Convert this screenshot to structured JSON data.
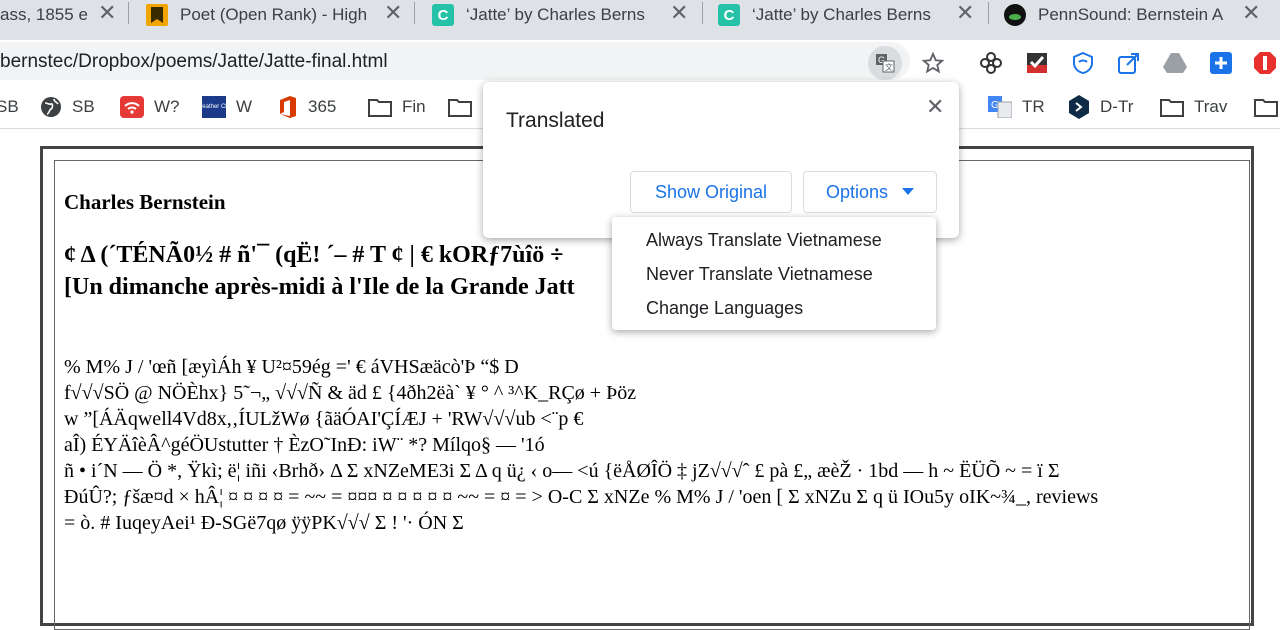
{
  "tabs": [
    {
      "title": "ass, 1855 e",
      "favicon": "page-icon"
    },
    {
      "title": "Poet (Open Rank) - High",
      "favicon": "bookmark-icon"
    },
    {
      "title": "‘Jatte’ by Charles Berns",
      "favicon": "c-letter-icon"
    },
    {
      "title": "‘Jatte’ by Charles Berns",
      "favicon": "c-letter-icon"
    },
    {
      "title": "PennSound: Bernstein A",
      "favicon": "pennsound-icon"
    }
  ],
  "url": "bernstec/Dropbox/poems/Jatte/Jatte-final.html",
  "bookmarks": [
    {
      "label": "SB"
    },
    {
      "label": "SB"
    },
    {
      "label": "W?"
    },
    {
      "label": "W"
    },
    {
      "label": "365"
    },
    {
      "label": "Fin"
    },
    {
      "label": "TR"
    },
    {
      "label": "D-Tr"
    },
    {
      "label": "Trav"
    }
  ],
  "weather_icon_text": "The Weather Channel",
  "translate_popup": {
    "title": "Translated",
    "show_original": "Show Original",
    "options": "Options",
    "menu": [
      "Always Translate Vietnamese",
      "Never Translate Vietnamese",
      "Change Languages"
    ]
  },
  "poem": {
    "author": "Charles Bernstein",
    "title_line1": "¢ Δ (´TÉNÃ0½ # ñ'¯ (qË! ´– # T ¢ | € kORƒ7ùîö ÷",
    "title_line2": "[Un dimanche après-midi à l'Ile de la Grande Jatt",
    "lines": [
      "% M% J / 'œñ [æyìÁh ¥ U²¤59ég =' € áVHSæäcò'Þ “$ D",
      "f√√√SÖ @ NÖÈhx} 5˜¬„ √√√Ñ & äd £ {4ðh2ëà` ¥ ° ^ ³^K_RÇø + Þöz",
      "w ”[ÁÄqwell4Vd8x,‚ÍULžWø {ãäÓAI'ÇÍÆJ + 'RW√√√ub <¨p €",
      "aÎ) ÉYÄîèÂ^géÖUstutter † ÈzO˜InÐ: iW¨ *? Mílqo§ — '1ó",
      "ñ • i´N — Ö *, Ÿkì; ë¦ iñi ‹Brhð› Δ Σ xNZeME3i Σ Δ q ü¿ ‹ o— <ú {ëÅØÎÖ ‡ jZ√√√ˆ £ pà £„ æèŽ · 1bd — h ~ ËÜÕ ~ = ï Σ",
      "ÐúÛ?; ƒšæ¤d × hÂ¦ ¤ ¤ ¤ ¤ = ~~ = ¤¤¤ ¤ ¤ ¤ ¤ ¤ ~~ = ¤ = > O-C Σ xNZe % M% J / 'oen [ Σ xNZu Σ q ü IOu5y oIK~¾_, reviews",
      "= ò. # IuqeyAei¹ Ð-SGë7qø ÿÿPK√√√ Σ ! '· ÓN Σ"
    ]
  },
  "colors": {
    "tabstrip": "#dee1e6",
    "accent": "#1a73e8",
    "office": "#d83b01",
    "ext_red": "#e8312f"
  }
}
